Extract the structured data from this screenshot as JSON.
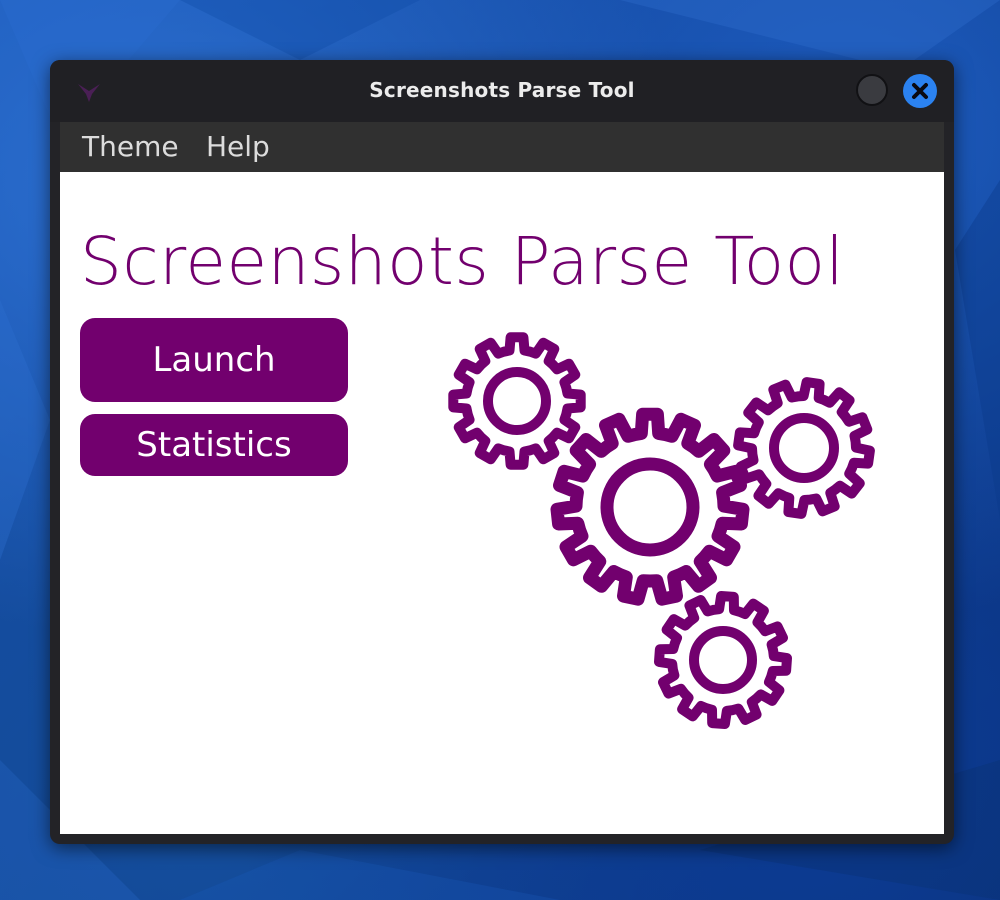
{
  "window": {
    "title": "Screenshots Parse Tool"
  },
  "menu": {
    "items": [
      "Theme",
      "Help"
    ]
  },
  "main": {
    "heading": "Screenshots Parse Tool",
    "launch_label": "Launch",
    "statistics_label": "Statistics"
  },
  "colors": {
    "accent": "#72006e",
    "titlebar": "#202024",
    "menubar": "#303030",
    "close_button": "#2b82f0"
  },
  "icons": {
    "app": "app-logo-icon",
    "minimize": "minimize-icon",
    "close": "close-icon",
    "illustration": "gears-icon"
  }
}
